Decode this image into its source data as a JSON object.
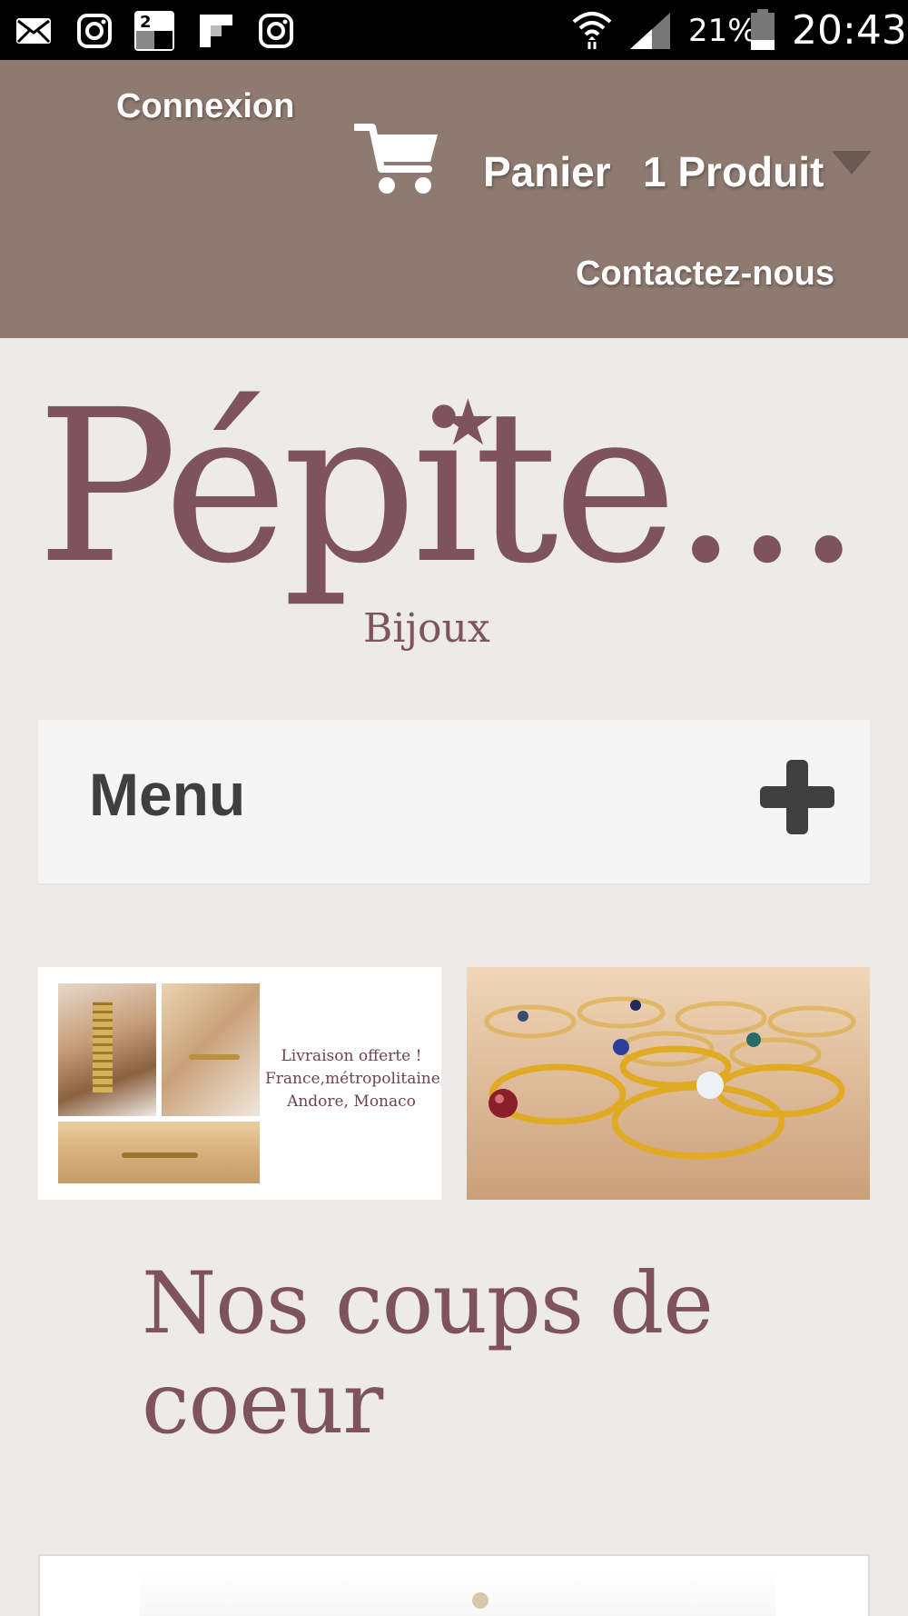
{
  "status_bar": {
    "battery": "21%",
    "time": "20:43",
    "icons": [
      "mail-icon",
      "instagram-icon",
      "app-2-icon",
      "flipboard-icon",
      "instagram-icon",
      "wifi-icon",
      "signal-icon",
      "battery-icon"
    ]
  },
  "header": {
    "login": "Connexion",
    "cart_label": "Panier",
    "cart_count": "1 Produit",
    "contact": "Contactez-nous",
    "background": "#8e7a70"
  },
  "logo": {
    "title": "Pépite...",
    "subtitle": "Bijoux",
    "color": "#7f525f"
  },
  "menu": {
    "label": "Menu"
  },
  "banners": {
    "left_promo_lines": [
      "Livraison offerte !",
      "France,métropolitaine,",
      "Andore, Monaco"
    ]
  },
  "section": {
    "title": "Nos coups de coeur"
  }
}
